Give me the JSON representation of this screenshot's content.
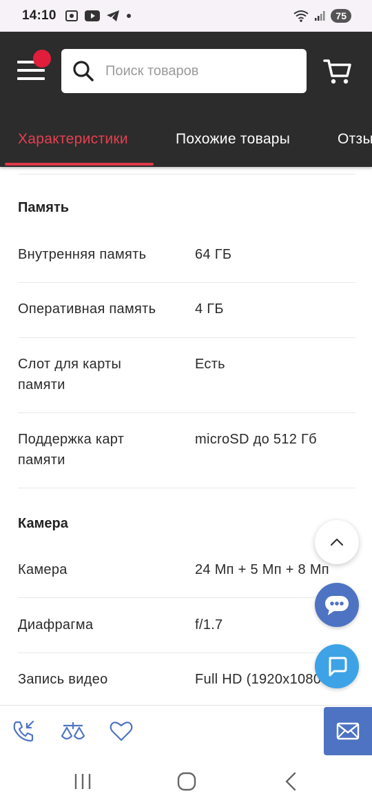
{
  "status_bar": {
    "time": "14:10",
    "battery": "75"
  },
  "header": {
    "search": {
      "placeholder": "Поиск товаров",
      "value": ""
    },
    "tabs": [
      {
        "label": "Характеристики",
        "active": true
      },
      {
        "label": "Похожие товары",
        "active": false
      },
      {
        "label": "Отзывы",
        "active": false
      }
    ],
    "accent_color": "#e0384a"
  },
  "specs": {
    "sections": [
      {
        "title": "Память",
        "rows": [
          {
            "label": "Внутренняя память",
            "value": "64 ГБ"
          },
          {
            "label": "Оперативная память",
            "value": "4 ГБ"
          },
          {
            "label": "Слот для карты памяти",
            "value": "Есть"
          },
          {
            "label": "Поддержка карт памяти",
            "value": "microSD до 512 Гб"
          }
        ]
      },
      {
        "title": "Камера",
        "rows": [
          {
            "label": "Камера",
            "value": "24 Мп + 5 Мп + 8 Мп"
          },
          {
            "label": "Диафрагма",
            "value": "f/1.7"
          },
          {
            "label": "Запись видео",
            "value": "Full HD (1920x1080"
          }
        ]
      }
    ]
  },
  "icons": {
    "menu": "menu-icon",
    "search": "search-icon",
    "cart": "cart-icon",
    "scroll_up": "chevron-up-icon",
    "bot": "chatbot-icon",
    "chat": "chat-bubble-icon",
    "callback": "phone-callback-icon",
    "compare": "scales-icon",
    "favorite": "heart-icon",
    "mail": "envelope-icon"
  }
}
